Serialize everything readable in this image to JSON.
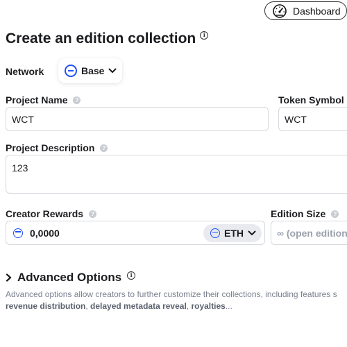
{
  "header": {
    "dashboard_label": "Dashboard"
  },
  "page": {
    "title": "Create an edition collection"
  },
  "network": {
    "label": "Network",
    "value": "Base"
  },
  "project_name": {
    "label": "Project Name",
    "value": "WCT"
  },
  "token_symbol": {
    "label": "Token Symbol",
    "value": "WCT"
  },
  "project_description": {
    "label": "Project Description",
    "value": "123"
  },
  "creator_rewards": {
    "label": "Creator Rewards",
    "value": "0,0000",
    "currency": "ETH"
  },
  "edition_size": {
    "label": "Edition Size",
    "placeholder": "∞ (open edition"
  },
  "advanced": {
    "title": "Advanced Options",
    "desc_prefix": "Advanced options allow creators to further customize their collections, including features s",
    "feature_1": "revenue distribution",
    "sep_1": ", ",
    "feature_2": "delayed metadata reveal",
    "sep_2": ", ",
    "feature_3": "royalties",
    "ellipsis": "..."
  },
  "colors": {
    "accent": "#2151f5",
    "border": "#d6d8de",
    "muted_text": "#7b8190"
  },
  "icons": [
    "dashboard-gauge-icon",
    "info-icon",
    "help-icon",
    "base-network-icon",
    "chevron-down-icon",
    "chevron-right-icon"
  ]
}
